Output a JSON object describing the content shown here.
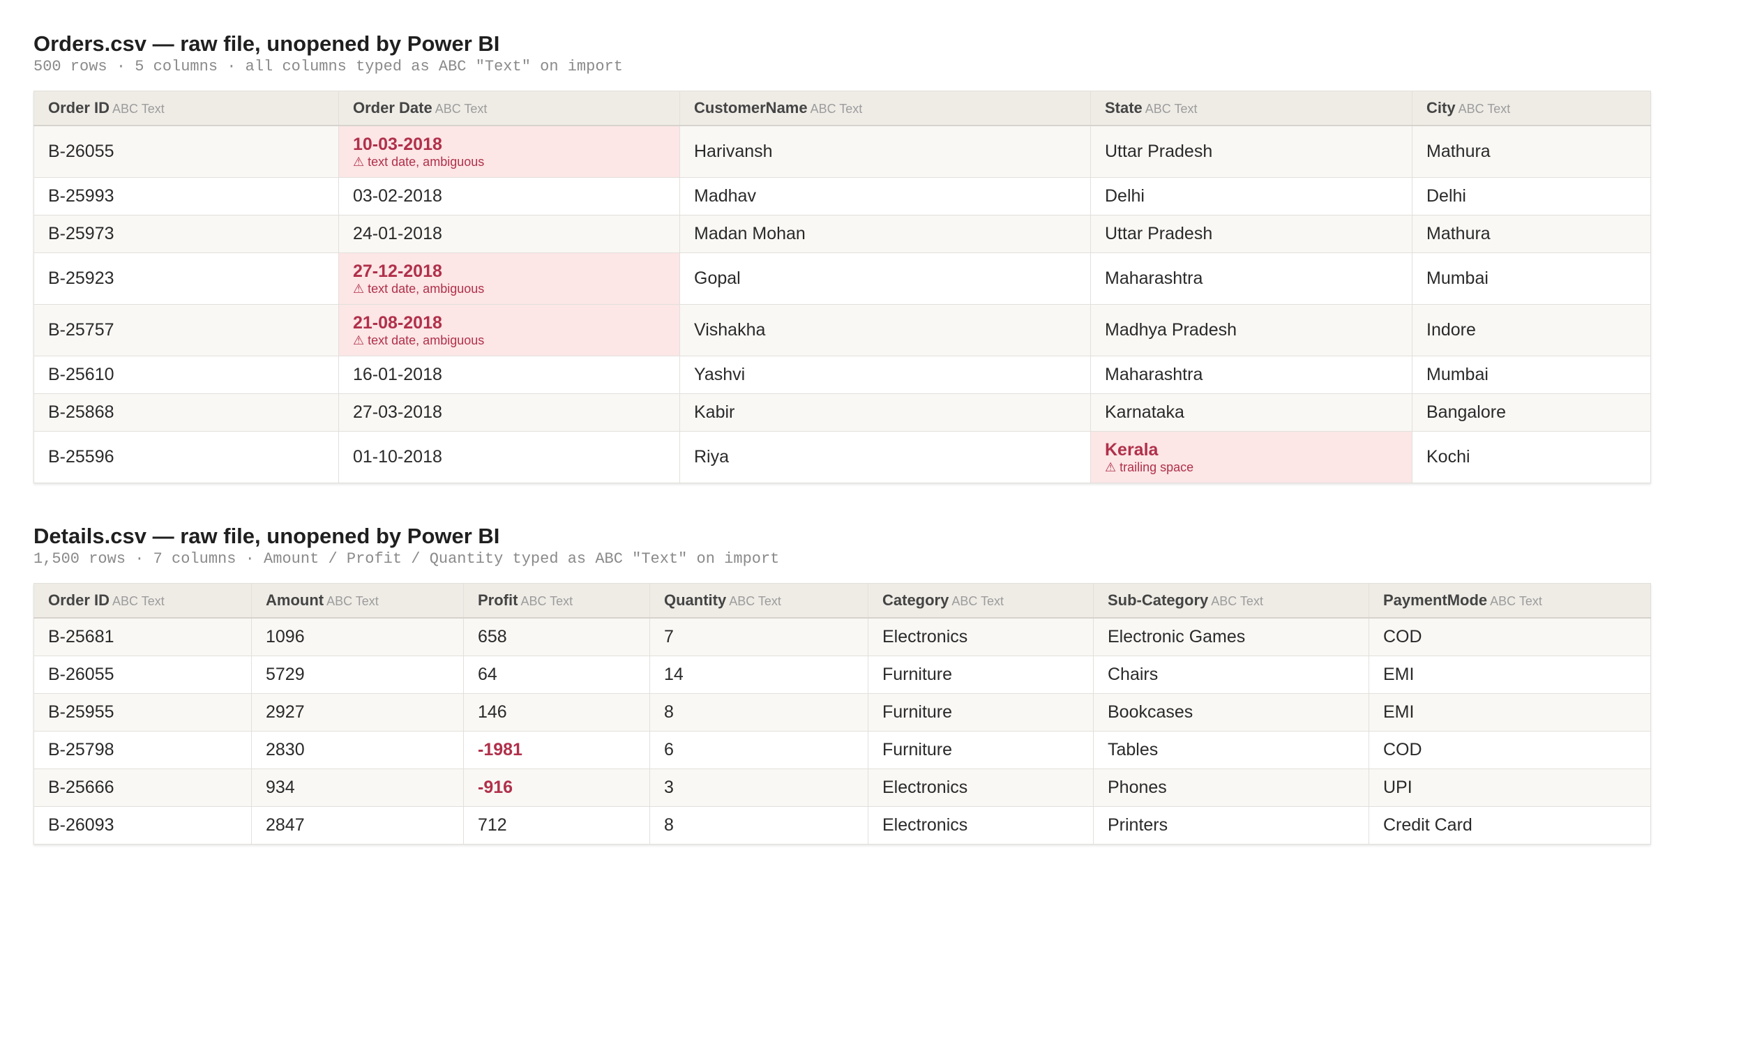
{
  "orders": {
    "title": "Orders.csv — raw file, unopened by Power BI",
    "subtitle": "500 rows · 5 columns · all columns typed as ABC \"Text\" on import",
    "type_label": "ABC Text",
    "columns": [
      "Order ID",
      "Order Date",
      "CustomerName",
      "State",
      "City"
    ],
    "rows": [
      {
        "order_id": "B-26055",
        "order_date": "10-03-2018",
        "date_note": "⚠ text date, ambiguous",
        "customer": "Harivansh",
        "state": "Uttar Pradesh",
        "city": "Mathura"
      },
      {
        "order_id": "B-25993",
        "order_date": "03-02-2018",
        "customer": "Madhav",
        "state": "Delhi",
        "city": "Delhi"
      },
      {
        "order_id": "B-25973",
        "order_date": "24-01-2018",
        "customer": "Madan Mohan",
        "state": "Uttar Pradesh",
        "city": "Mathura"
      },
      {
        "order_id": "B-25923",
        "order_date": "27-12-2018",
        "date_note": "⚠ text date, ambiguous",
        "customer": "Gopal",
        "state": "Maharashtra",
        "city": "Mumbai"
      },
      {
        "order_id": "B-25757",
        "order_date": "21-08-2018",
        "date_note": "⚠ text date, ambiguous",
        "customer": "Vishakha",
        "state": "Madhya Pradesh",
        "city": "Indore"
      },
      {
        "order_id": "B-25610",
        "order_date": "16-01-2018",
        "customer": "Yashvi",
        "state": "Maharashtra",
        "city": "Mumbai"
      },
      {
        "order_id": "B-25868",
        "order_date": "27-03-2018",
        "customer": "Kabir",
        "state": "Karnataka",
        "city": "Bangalore"
      },
      {
        "order_id": "B-25596",
        "order_date": "01-10-2018",
        "customer": "Riya",
        "state": "Kerala",
        "state_note": "⚠ trailing space",
        "city": "Kochi"
      }
    ]
  },
  "details": {
    "title": "Details.csv — raw file, unopened by Power BI",
    "subtitle": "1,500 rows · 7 columns · Amount / Profit / Quantity typed as ABC \"Text\" on import",
    "type_label": "ABC Text",
    "columns": [
      "Order ID",
      "Amount",
      "Profit",
      "Quantity",
      "Category",
      "Sub-Category",
      "PaymentMode"
    ],
    "rows": [
      {
        "order_id": "B-25681",
        "amount": "1096",
        "profit": "658",
        "quantity": "7",
        "category": "Electronics",
        "sub_category": "Electronic Games",
        "payment_mode": "COD"
      },
      {
        "order_id": "B-26055",
        "amount": "5729",
        "profit": "64",
        "quantity": "14",
        "category": "Furniture",
        "sub_category": "Chairs",
        "payment_mode": "EMI"
      },
      {
        "order_id": "B-25955",
        "amount": "2927",
        "profit": "146",
        "quantity": "8",
        "category": "Furniture",
        "sub_category": "Bookcases",
        "payment_mode": "EMI"
      },
      {
        "order_id": "B-25798",
        "amount": "2830",
        "profit": "-1981",
        "quantity": "6",
        "category": "Furniture",
        "sub_category": "Tables",
        "payment_mode": "COD"
      },
      {
        "order_id": "B-25666",
        "amount": "934",
        "profit": "-916",
        "quantity": "3",
        "category": "Electronics",
        "sub_category": "Phones",
        "payment_mode": "UPI"
      },
      {
        "order_id": "B-26093",
        "amount": "2847",
        "profit": "712",
        "quantity": "8",
        "category": "Electronics",
        "sub_category": "Printers",
        "payment_mode": "Credit Card"
      }
    ]
  },
  "colors": {
    "flag_background": "#fce6e6",
    "flag_text": "#b0304a",
    "header_background": "#efece6"
  }
}
